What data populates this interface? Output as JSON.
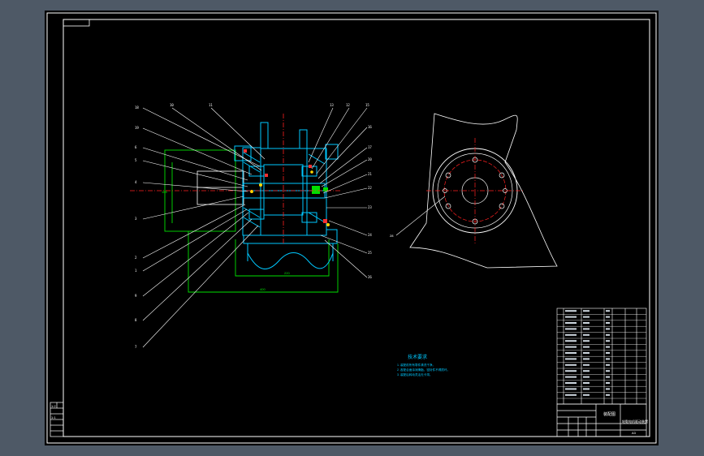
{
  "drawing": {
    "background": "#000000",
    "frame_color": "#ffffff",
    "section_color": "#00c8ff",
    "centerline_color": "#ff2020",
    "dimension_color": "#00e000",
    "note_color": "#00c8ff",
    "tech_title": "技术要求",
    "tech_notes": [
      "1. 装配前所有零件清洗干净。",
      "2. 各配合面涂润滑脂，密封件不得损坏。",
      "3. 装配后转动灵活无卡滞。"
    ],
    "title_block": {
      "name": "装配图",
      "subtitle": "轮毂电机驱动装置",
      "sheet": "A3",
      "side_labels": [
        "1:2",
        "1:1"
      ]
    },
    "dimension_values": {
      "horizontal": "400",
      "inner": "220",
      "vertical": "185"
    },
    "left_leader_labels": [
      "18",
      "19",
      "6",
      "5",
      "4",
      "3",
      "2",
      "1",
      "9",
      "8",
      "7",
      "10",
      "11"
    ],
    "top_leader_labels": [
      "13",
      "12",
      "15",
      "16",
      "17"
    ],
    "right_leader_labels": [
      "20",
      "21",
      "22",
      "23",
      "24",
      "25",
      "26",
      "27"
    ],
    "side_view_label": "28"
  }
}
